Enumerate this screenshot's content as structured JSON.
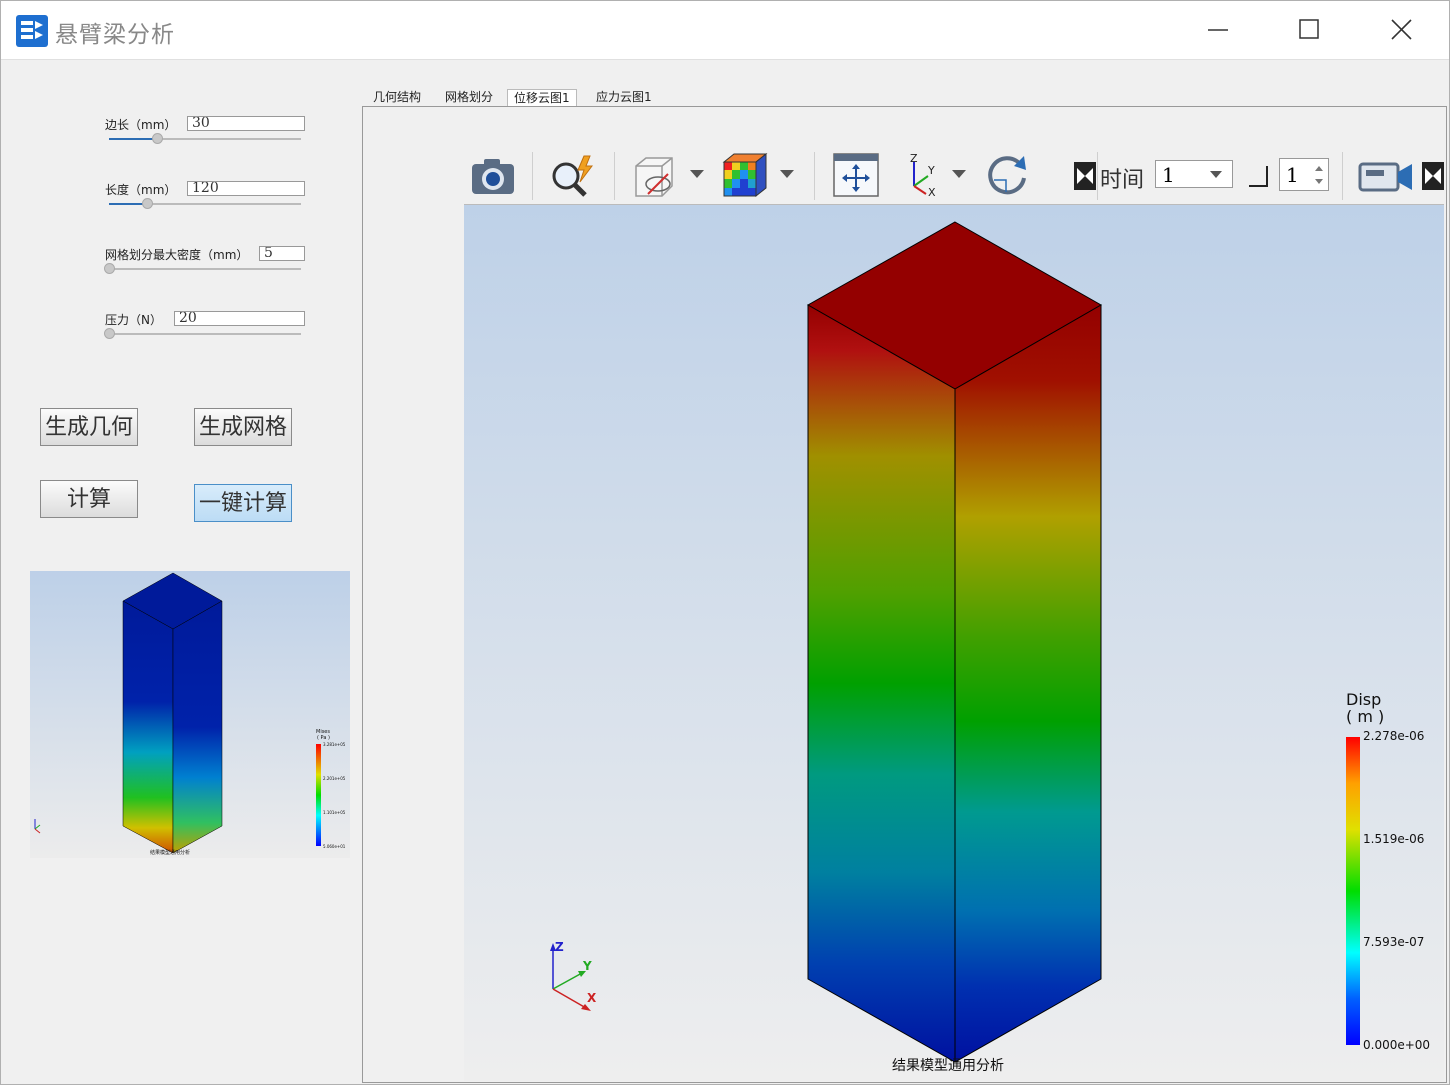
{
  "window": {
    "title": "悬臂梁分析"
  },
  "params": {
    "edge": {
      "label": "边长（mm）",
      "value": "30",
      "level": 0.25
    },
    "length": {
      "label": "长度（mm）",
      "value": "120",
      "level": 0.2
    },
    "mesh": {
      "label": "网格划分最大密度（mm）",
      "value": "5",
      "level": 0.0
    },
    "force": {
      "label": "压力（N）",
      "value": "20",
      "level": 0.0
    }
  },
  "buttons": {
    "gen_geometry": "生成几何",
    "gen_mesh": "生成网格",
    "compute": "计算",
    "one_click": "一键计算"
  },
  "thumbnail": {
    "legend_title": "Mises",
    "legend_unit": "( Pa )",
    "legend_ticks": [
      "3.281e+05",
      "2.201e+05",
      "1.101e+05",
      "5.060e+01"
    ],
    "footer": "结果模型通用分析"
  },
  "tabs": [
    "几何结构",
    "网格划分",
    "位移云图1",
    "应力云图1"
  ],
  "toolbar": {
    "time_label": "时间",
    "time_value": "1",
    "step_value": "1",
    "icons": [
      "camera-icon",
      "zoom-icon",
      "visibility-icon",
      "colormap-icon",
      "fit-view-icon",
      "axes-icon",
      "rotate-icon",
      "video-icon"
    ]
  },
  "viewport": {
    "legend_title": "Disp",
    "legend_unit": "( m )",
    "legend_ticks": [
      "2.278e-06",
      "1.519e-06",
      "7.593e-07",
      "0.000e+00"
    ],
    "footer": "结果模型通用分析",
    "axis_labels": {
      "z": "Z",
      "y": "Y",
      "x": "X"
    }
  },
  "colors": {
    "top_face": "#940000",
    "accent_blue": "#2c6db4",
    "button_active": "#bcdcf5"
  }
}
